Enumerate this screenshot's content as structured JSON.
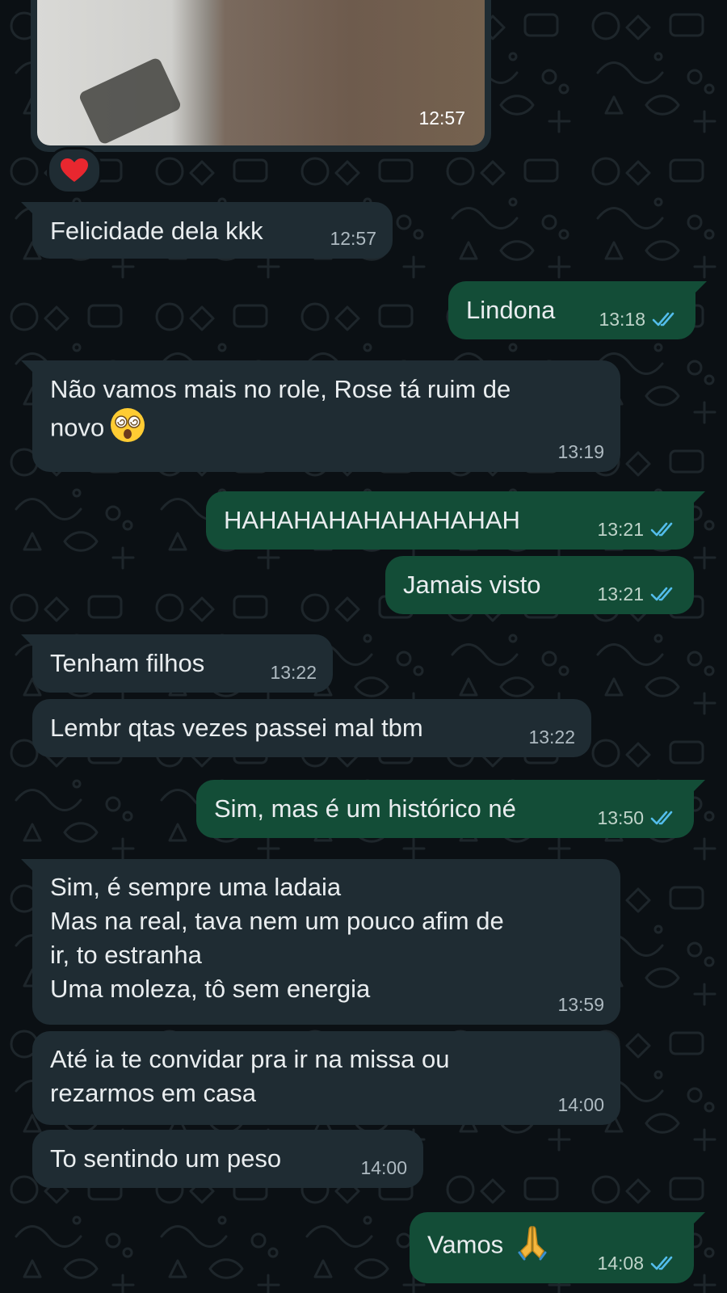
{
  "photo_message": {
    "time": "12:57",
    "reaction": "heart"
  },
  "messages": [
    {
      "text": "Felicidade dela kkk",
      "time": "12:57"
    },
    {
      "text": "Lindona",
      "time": "13:18"
    },
    {
      "text": "Não vamos mais no role, Rose tá ruim de\nnovo",
      "time": "13:19",
      "emoji": "dizzy-face"
    },
    {
      "text": "HAHAHAHAHAHAHAHAH",
      "time": "13:21"
    },
    {
      "text": "Jamais visto",
      "time": "13:21"
    },
    {
      "text": "Tenham filhos",
      "time": "13:22"
    },
    {
      "text": "Lembr qtas vezes passei mal tbm",
      "time": "13:22"
    },
    {
      "text": "Sim, mas é um histórico né",
      "time": "13:50"
    },
    {
      "text": "Sim, é sempre uma ladaia\nMas na real, tava nem um pouco afim de\nir, to estranha\nUma moleza, tô sem energia",
      "time": "13:59"
    },
    {
      "text": "Até ia te convidar pra ir na missa ou\nrezarmos em casa",
      "time": "14:00"
    },
    {
      "text": "To sentindo um peso",
      "time": "14:00"
    },
    {
      "text": "Vamos",
      "time": "14:08",
      "emoji": "praying-hands"
    }
  ],
  "colors": {
    "background": "#0b1014",
    "incoming_bubble": "#1f2c33",
    "outgoing_bubble": "#134d37",
    "read_ticks": "#53bdeb"
  }
}
